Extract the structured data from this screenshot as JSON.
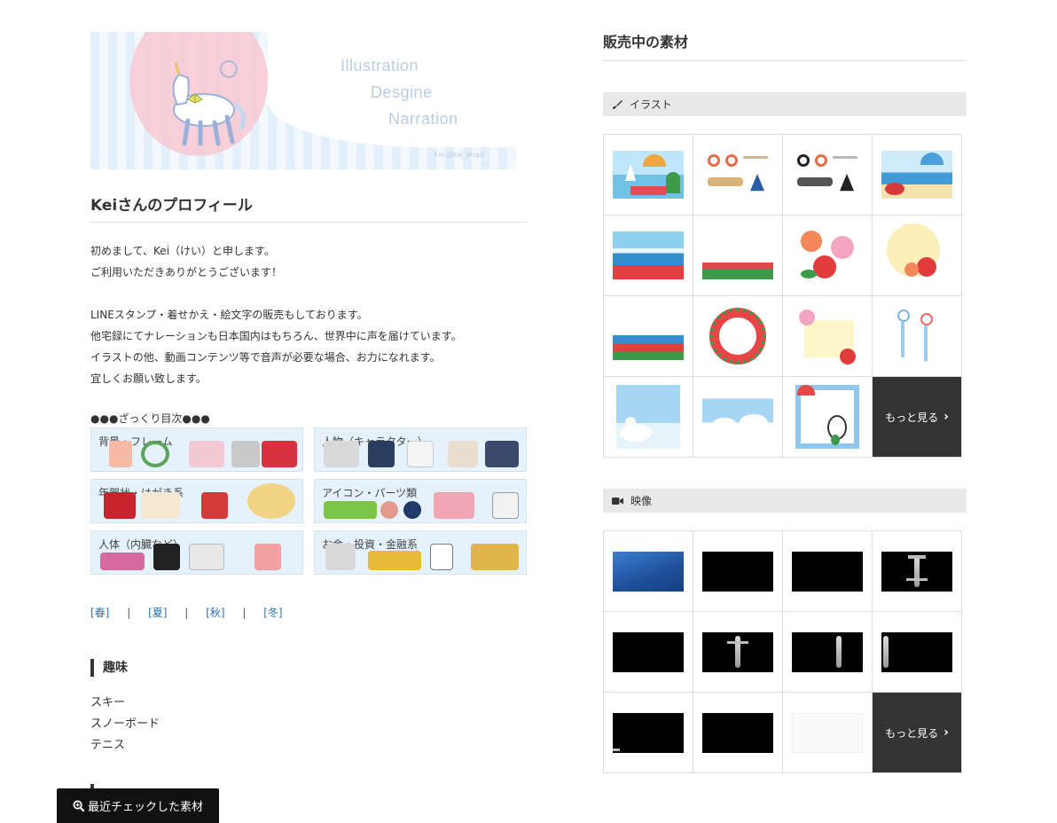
{
  "profile": {
    "banner": {
      "line1": "Illustration",
      "line2": "Desgine",
      "line3": "Narration",
      "signature": "Kei @kei_drops"
    },
    "title": "Keiさんのプロフィール",
    "intro": [
      "初めまして、Kei（けい）と申します。",
      "ご利用いただきありがとうございます！",
      "",
      "LINEスタンプ・着せかえ・絵文字の販売もしております。",
      "他宅録にてナレーションも日本国内はもちろん、世界中に声を届けています。",
      "イラストの他、動画コンテンツ等で音声が必要な場合、お力になれます。",
      "宜しくお願い致します。"
    ],
    "toc_label": "●●●ざっくり目次●●●",
    "toc": [
      {
        "label": "背景・フレーム"
      },
      {
        "label": "人物（キャラクター）"
      },
      {
        "label": "年賀状・はがき系"
      },
      {
        "label": "アイコン・パーツ類"
      },
      {
        "label": "人体（内臓など）"
      },
      {
        "label": "お金・投資・金融系"
      }
    ],
    "seasons": [
      "[春]",
      "[夏]",
      "[秋]",
      "[冬]"
    ],
    "season_sep": "|",
    "hobby_title": "趣味",
    "hobbies": [
      "スキー",
      "スノーボード",
      "テニス"
    ]
  },
  "recent_button": {
    "label": "最近チェックした素材",
    "icon": "search-plus-icon"
  },
  "sales": {
    "title": "販売中の素材",
    "illust": {
      "label": "イラスト",
      "icon": "brush-icon",
      "more_label": "もっと見る"
    },
    "video": {
      "label": "映像",
      "icon": "video-camera-icon",
      "more_label": "もっと見る"
    }
  },
  "colors": {
    "accent_dark": "#333333",
    "link": "#2a6fb0",
    "category_bg": "#e8e8e8"
  }
}
